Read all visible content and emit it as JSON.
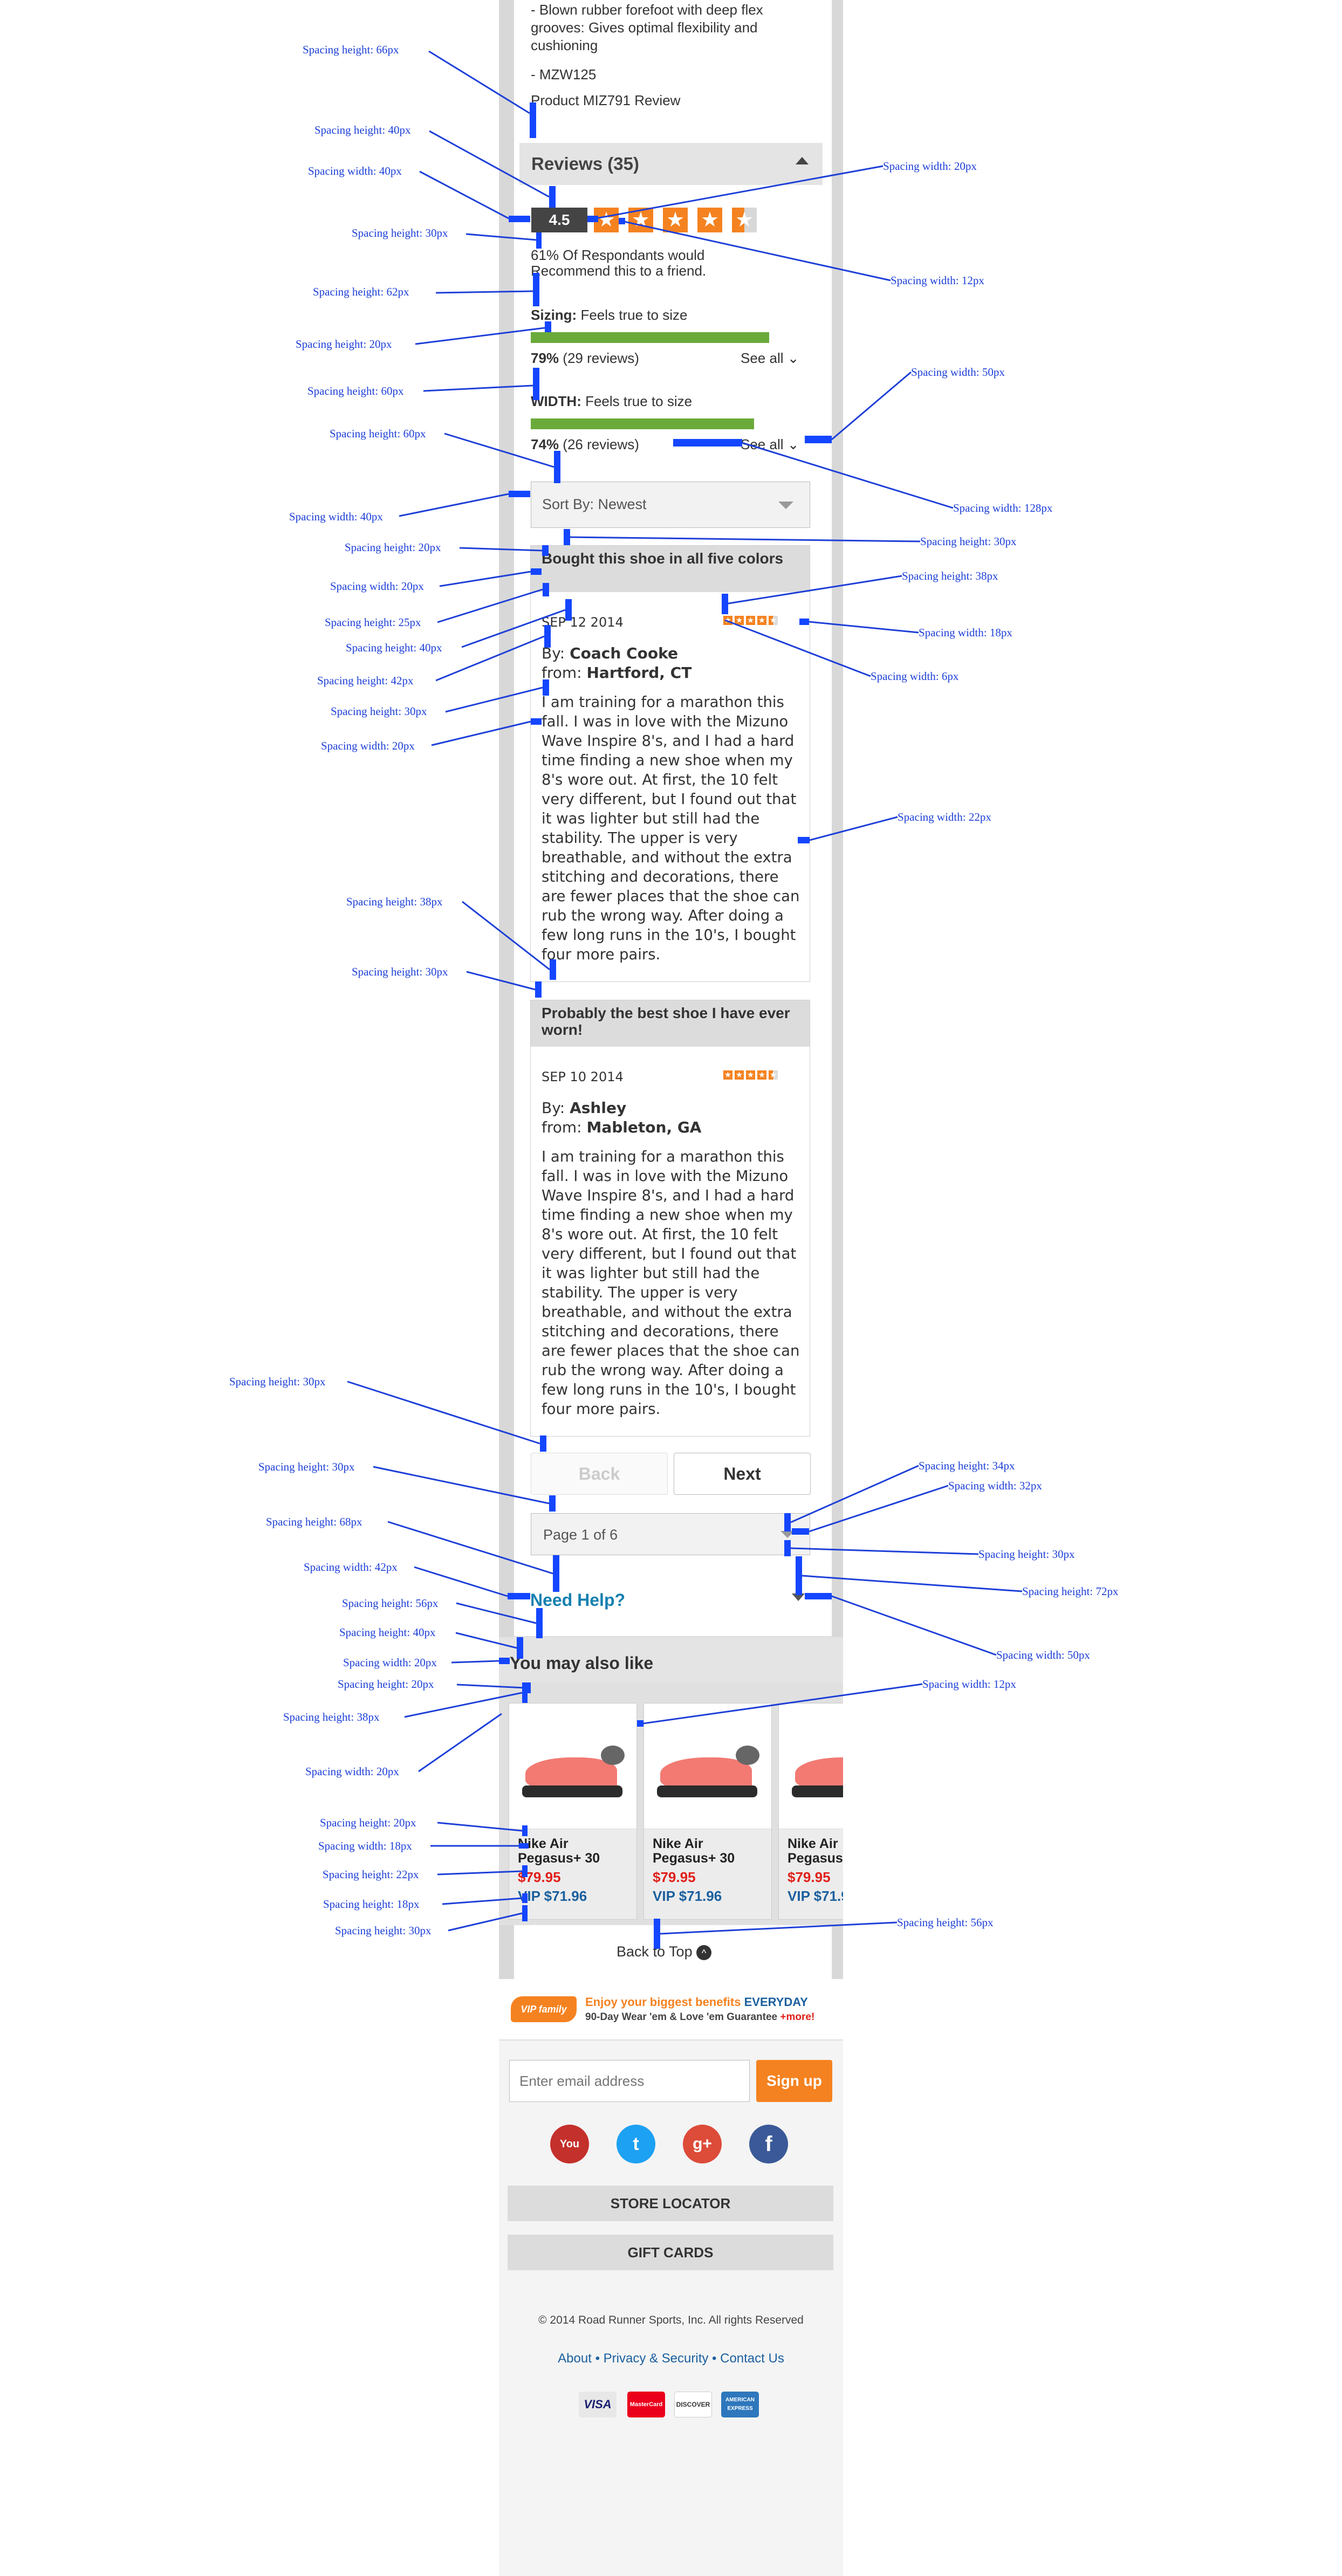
{
  "product": {
    "bullets": [
      "- Blown rubber forefoot with deep flex grooves: Gives optimal flexibility and cushioning",
      "- MZW125"
    ],
    "review_title": "Product MIZ791 Review"
  },
  "reviews": {
    "header": "Reviews (35)",
    "rating": "4.5",
    "stars": 4.5,
    "recommend_text": "61% Of Respondants would Recommend this to a friend.",
    "sizing": {
      "label": "Sizing:",
      "value": "Feels true to size",
      "percent_text": "79%",
      "count_text": "(29 reviews)",
      "percent": 79,
      "see_all": "See all"
    },
    "width": {
      "label": "WIDTH:",
      "value": "Feels true to size",
      "percent_text": "74%",
      "count_text": "(26 reviews)",
      "percent": 74,
      "see_all": "See all"
    },
    "sort_label": "Sort By: Newest",
    "items": [
      {
        "title": "Bought this shoe in all five colors",
        "date": "SEP 12 2014",
        "by_label": "By:",
        "author": "Coach Cooke",
        "from_label": "from:",
        "location": "Hartford, CT",
        "text": "I am training for a marathon this fall. I was in love with the Mizuno Wave Inspire 8's, and I had a hard time finding a new shoe when my 8's wore out. At first, the 10 felt very different, but I found out that it was lighter but still had the stability. The upper is very breathable, and without the extra stitching and decorations, there are fewer places that the shoe can rub the wrong way. After doing a few long runs in the 10's, I bought four more pairs.",
        "stars": 4.5
      },
      {
        "title": "Probably the best shoe I have ever worn!",
        "date": "SEP 10 2014",
        "by_label": "By:",
        "author": "Ashley",
        "from_label": "from:",
        "location": "Mableton, GA",
        "text": "I am training for a marathon this fall. I was in love with the Mizuno Wave Inspire 8's, and I had a hard time finding a new shoe when my 8's wore out. At first, the 10 felt very different, but I found out that it was lighter but still had the stability. The upper is very breathable, and without the extra stitching and decorations, there are fewer places that the shoe can rub the wrong way. After doing a few long runs in the 10's, I bought four more pairs.",
        "stars": 4.5
      }
    ],
    "back_label": "Back",
    "next_label": "Next",
    "page_label": "Page 1 of 6"
  },
  "need_help": "Need Help?",
  "also_like": {
    "title": "You may also like",
    "products": [
      {
        "name": "Nike Air Pegasus+ 30",
        "price": "$79.95",
        "vip": "VIP $71.96"
      },
      {
        "name": "Nike Air Pegasus+ 30",
        "price": "$79.95",
        "vip": "VIP $71.96"
      },
      {
        "name": "Nike Air Pegasus+ 30",
        "price": "$79.95",
        "vip": "VIP $71.96"
      }
    ]
  },
  "back_to_top": "Back to Top",
  "footer": {
    "vip_logo": "VIP family",
    "vip_line1_a": "Enjoy your biggest benefits",
    "vip_line1_b": "EVERYDAY",
    "vip_line2_a": "90-Day Wear 'em & Love 'em Guarantee",
    "vip_line2_b": "+more!",
    "email_placeholder": "Enter email address",
    "signup": "Sign up",
    "social": [
      "YouTube",
      "Twitter",
      "Google+",
      "Facebook"
    ],
    "store_locator": "STORE LOCATOR",
    "gift_cards": "GIFT CARDS",
    "copyright": "© 2014 Road Runner Sports, Inc. All rights Reserved",
    "links": [
      "About",
      "Privacy & Security",
      "Contact Us"
    ],
    "cards": [
      "VISA",
      "MasterCard",
      "DISCOVER",
      "AMERICAN EXPRESS"
    ]
  },
  "annotations": {
    "a1": "Spacing height: 66px",
    "a2": "Spacing height: 40px",
    "a3": "Spacing width: 40px",
    "a4": "Spacing height: 30px",
    "a5": "Spacing height: 62px",
    "a6": "Spacing height: 20px",
    "a7": "Spacing height: 60px",
    "a8": "Spacing height: 60px",
    "a9": "Spacing width: 40px",
    "a10": "Spacing height: 20px",
    "a11": "Spacing width: 20px",
    "a12": "Spacing height: 25px",
    "a13": "Spacing height: 40px",
    "a14": "Spacing height: 42px",
    "a15": "Spacing height: 30px",
    "a16": "Spacing width: 20px",
    "a17": "Spacing height: 38px",
    "a18": "Spacing height: 30px",
    "a19": "Spacing height: 30px",
    "a20": "Spacing height: 30px",
    "a21": "Spacing height: 68px",
    "a22": "Spacing width: 42px",
    "a23": "Spacing height: 56px",
    "a24": "Spacing height: 40px",
    "a25": "Spacing width: 20px",
    "a26": "Spacing height: 20px",
    "a27": "Spacing height: 38px",
    "a28": "Spacing width: 20px",
    "a29": "Spacing height: 20px",
    "a30": "Spacing width: 18px",
    "a31": "Spacing height: 22px",
    "a32": "Spacing height: 18px",
    "a33": "Spacing height: 30px",
    "r1": "Spacing width: 20px",
    "r2": "Spacing width: 12px",
    "r3": "Spacing width: 50px",
    "r4": "Spacing width: 128px",
    "r5": "Spacing height: 30px",
    "r6": "Spacing height: 38px",
    "r7": "Spacing width: 18px",
    "r8": "Spacing width: 6px",
    "r9": "Spacing width: 22px",
    "r10": "Spacing height: 34px",
    "r11": "Spacing width: 32px",
    "r12": "Spacing height: 30px",
    "r13": "Spacing height: 72px",
    "r14": "Spacing width: 50px",
    "r15": "Spacing width: 12px",
    "r16": "Spacing height: 56px"
  }
}
